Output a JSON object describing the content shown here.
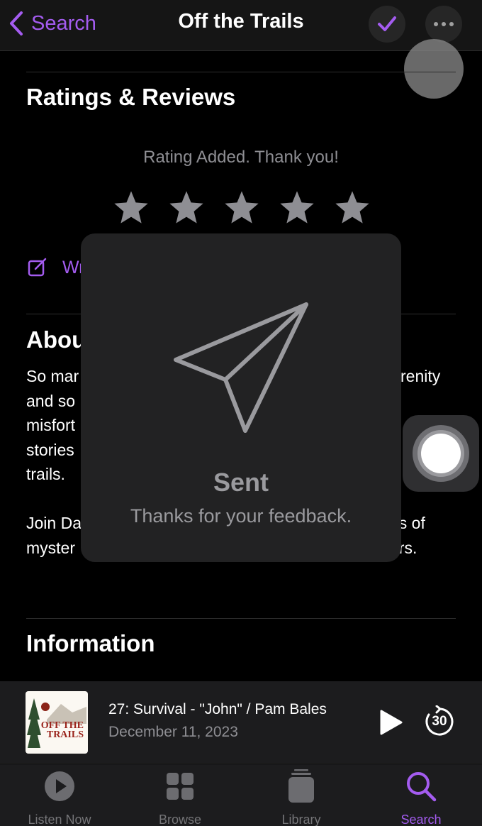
{
  "nav": {
    "back_label": "Search",
    "title": "Off the Trails"
  },
  "ratings": {
    "heading": "Ratings & Reviews",
    "message": "Rating Added. Thank you!",
    "stars_total": 5,
    "write_review_label": "Wr"
  },
  "about": {
    "heading": "Abou",
    "lines": [
      "So mar",
      "and so",
      "misfort",
      "stories",
      "trails."
    ],
    "right_fragments": [
      "renity",
      "",
      "e"
    ],
    "line2_left": "Join Da",
    "line2_left_b": "myster",
    "line2_right": "es of",
    "line2_right_b": "ors."
  },
  "information": {
    "heading": "Information"
  },
  "toast": {
    "icon": "paper-plane-icon",
    "title": "Sent",
    "subtitle": "Thanks for your feedback."
  },
  "player": {
    "artwork_text": "OFF THE TRAILS",
    "episode_title": "27: Survival - \"John\" / Pam Bales",
    "episode_date": "December 11, 2023",
    "skip_seconds": "30"
  },
  "tabs": [
    {
      "label": "Listen Now",
      "icon": "play-circle-icon"
    },
    {
      "label": "Browse",
      "icon": "grid-icon"
    },
    {
      "label": "Library",
      "icon": "library-icon"
    },
    {
      "label": "Search",
      "icon": "search-icon"
    }
  ],
  "colors": {
    "accent": "#a45cf0",
    "background": "#000000",
    "secondary_text": "#8e8e93"
  }
}
